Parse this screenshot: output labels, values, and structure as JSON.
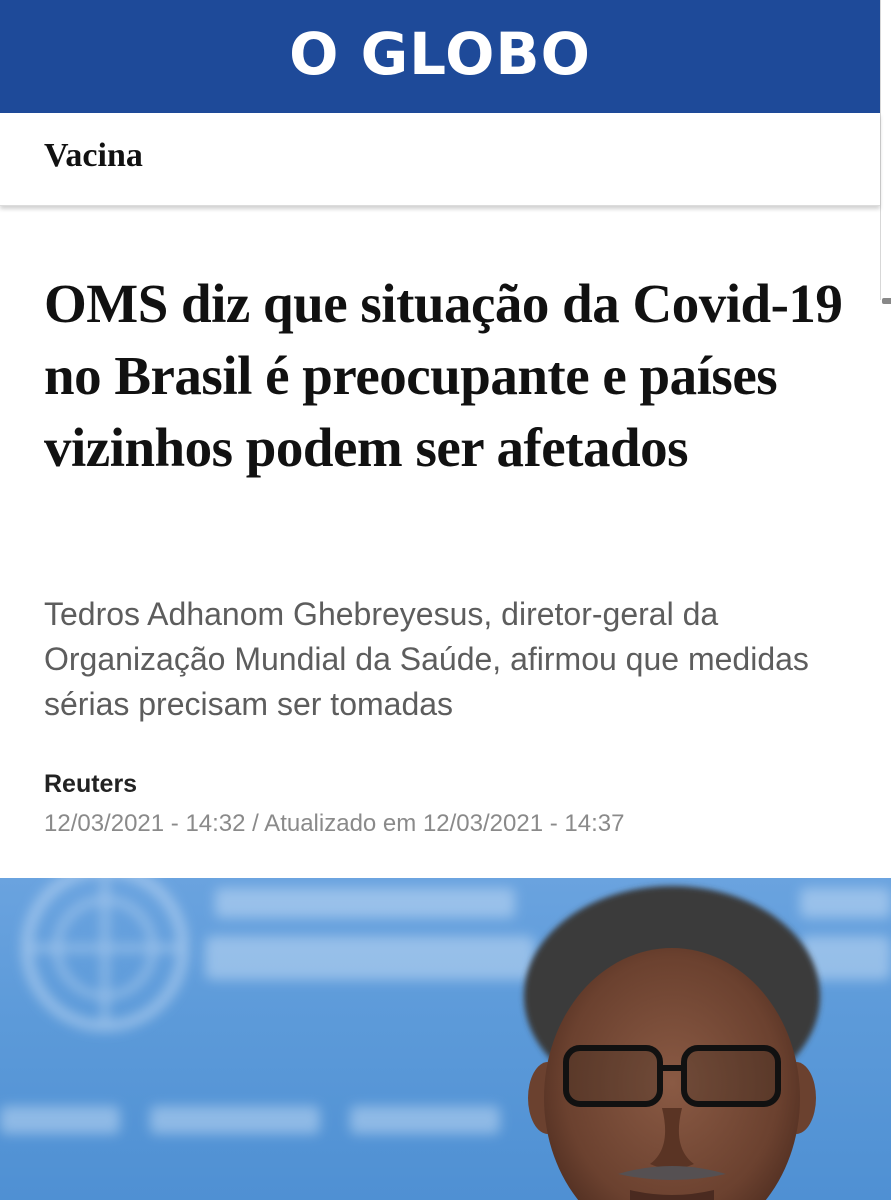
{
  "header": {
    "logo_text": "O GLOBO",
    "background_color": "#1e4a99"
  },
  "section": {
    "label": "Vacina"
  },
  "article": {
    "headline": "OMS diz que situação da Covid-19 no Brasil é preocupante e países vizinhos podem ser afetados",
    "subtitle": "Tedros Adhanom Ghebreyesus, diretor-geral da Organização Mundial da Saúde, afirmou que medidas sérias precisam ser tomadas",
    "author": "Reuters",
    "dateline": "12/03/2021 - 14:32 / Atualizado em 12/03/2021 - 14:37"
  },
  "photo": {
    "backdrop_color": "#5c9ad9"
  }
}
